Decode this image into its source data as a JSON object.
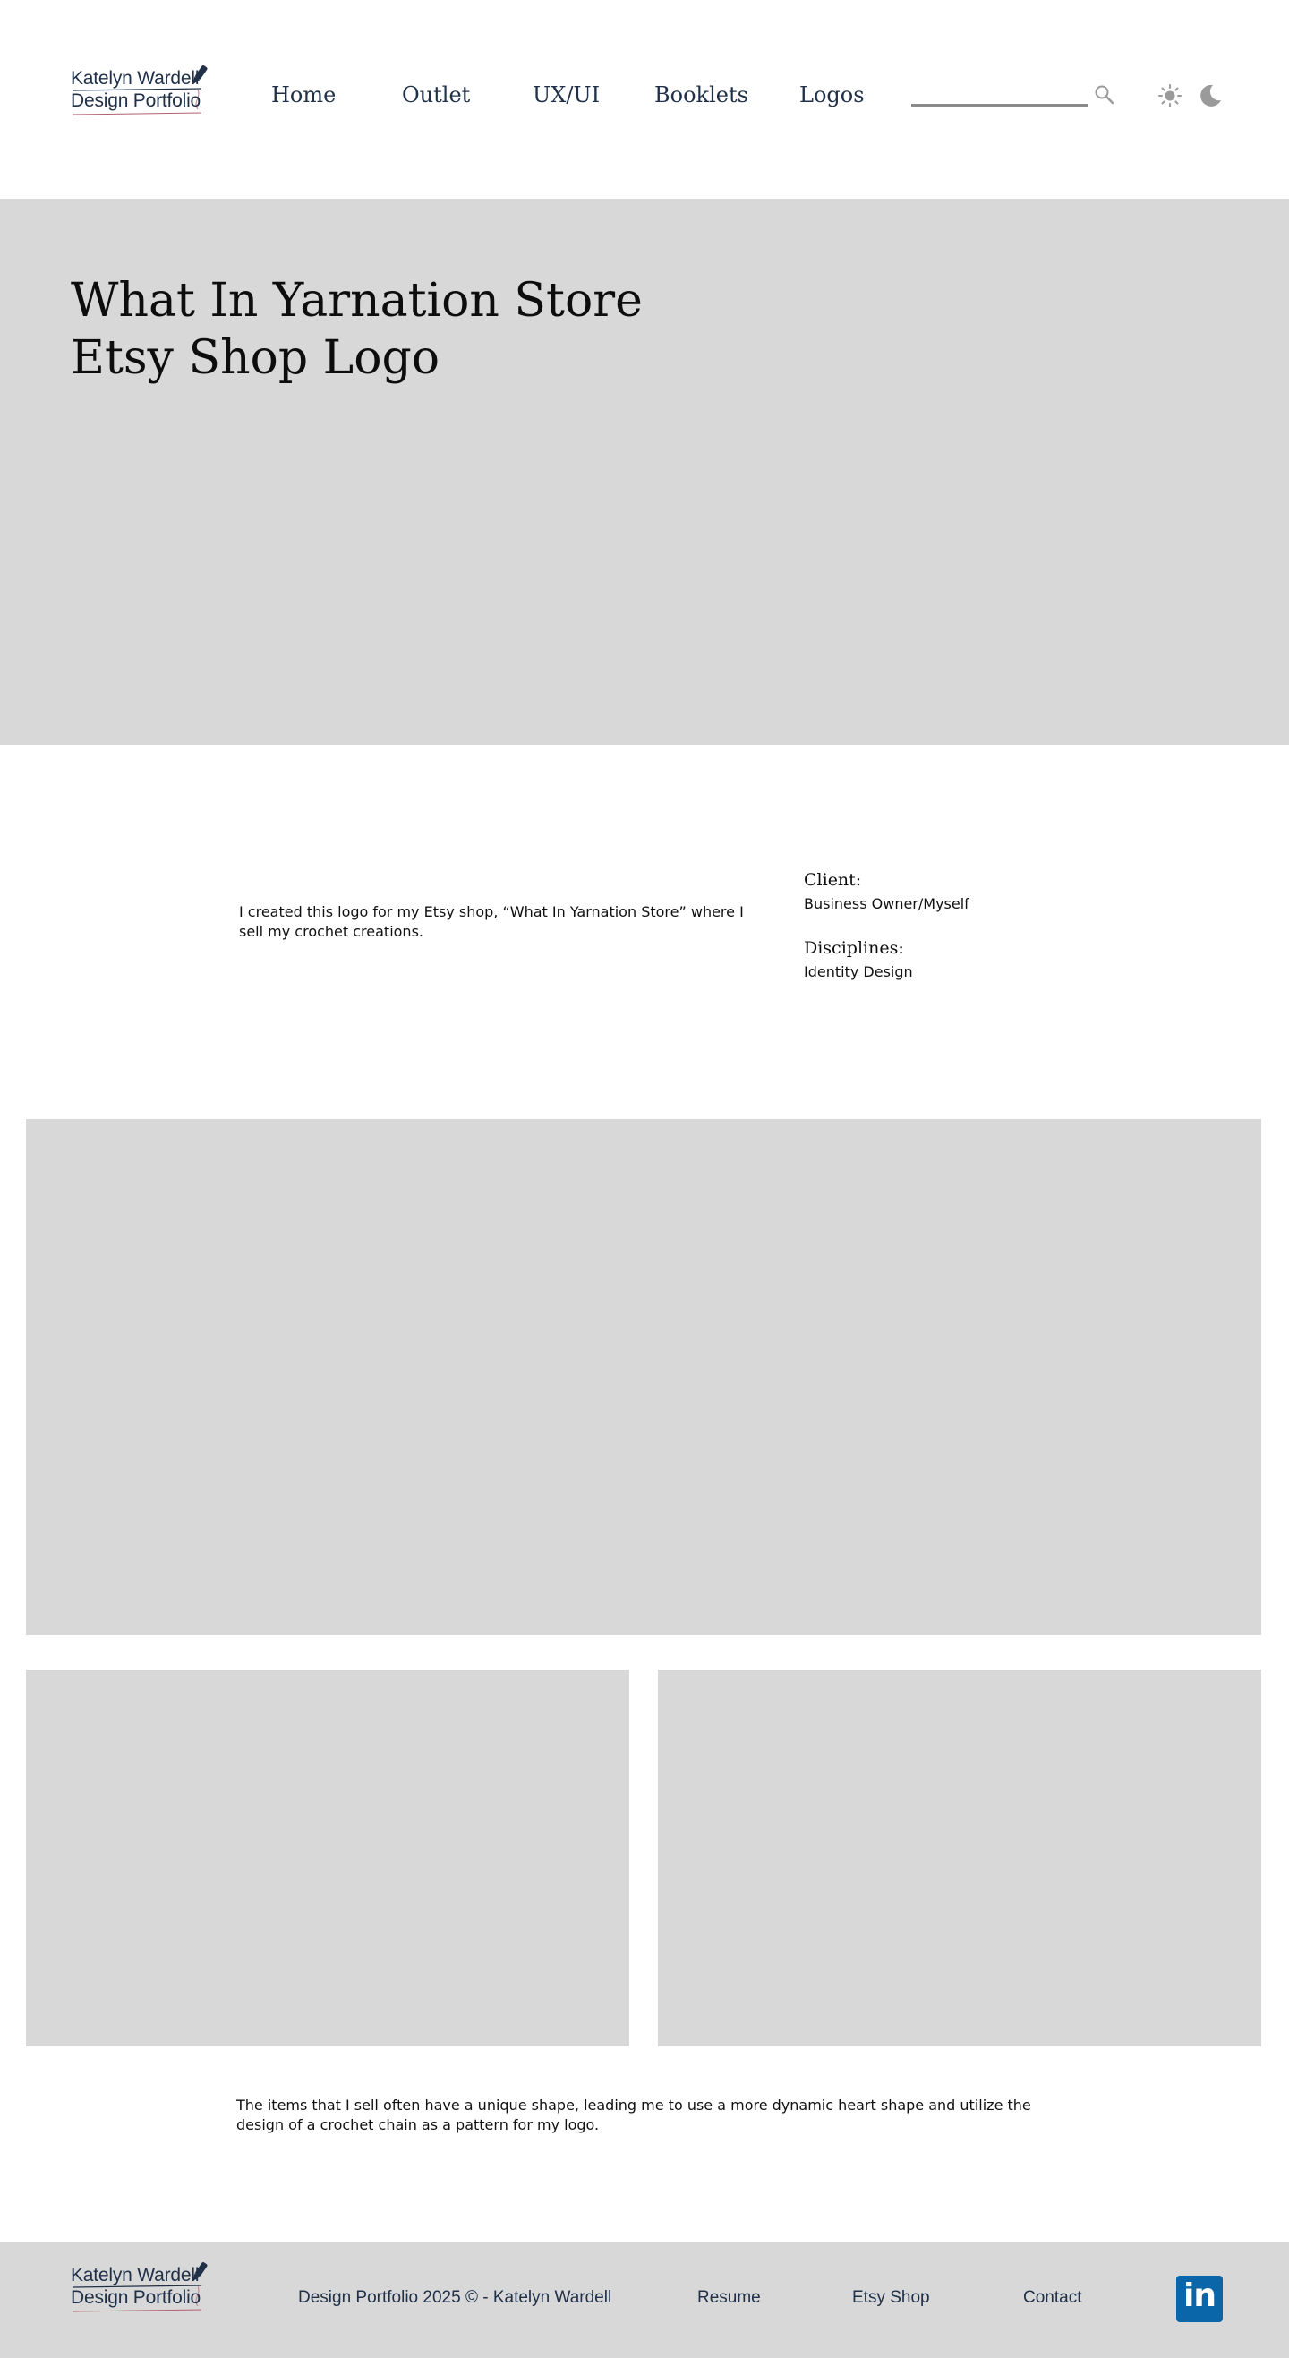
{
  "brand": {
    "line1": "Katelyn Wardell",
    "line2": "Design Portfolio"
  },
  "nav": {
    "items": [
      {
        "label": "Home"
      },
      {
        "label": "Outlet"
      },
      {
        "label": "UX/UI"
      },
      {
        "label": "Booklets"
      },
      {
        "label": "Logos"
      }
    ]
  },
  "search": {
    "value": "",
    "placeholder": ""
  },
  "icons": {
    "search": "search-icon",
    "light_mode": "sun-icon",
    "dark_mode": "moon-icon",
    "linkedin": "linkedin-icon"
  },
  "hero": {
    "title_line1": "What In Yarnation Store",
    "title_line2": "Etsy Shop Logo"
  },
  "project": {
    "description": "I created this logo for my Etsy shop, “What In Yarnation Store” where I sell my crochet creations.",
    "client_label": "Client:",
    "client_value": "Business Owner/Myself",
    "disciplines_label": "Disciplines:",
    "disciplines_value": "Identity Design",
    "description_2": "The items that I sell often have a unique shape, leading me to use a more dynamic heart shape and utilize the design of a crochet chain as a pattern for my logo."
  },
  "footer": {
    "copyright": "Design Portfolio 2025 © - Katelyn Wardell",
    "links": [
      {
        "label": "Resume"
      },
      {
        "label": "Etsy Shop"
      },
      {
        "label": "Contact"
      }
    ],
    "linkedin_glyph": "in"
  },
  "colors": {
    "brand_navy": "#1f3048",
    "placeholder_gray": "#d8d8d8",
    "linkedin_blue": "#0a66a8",
    "icon_gray": "#9a9a9a"
  }
}
